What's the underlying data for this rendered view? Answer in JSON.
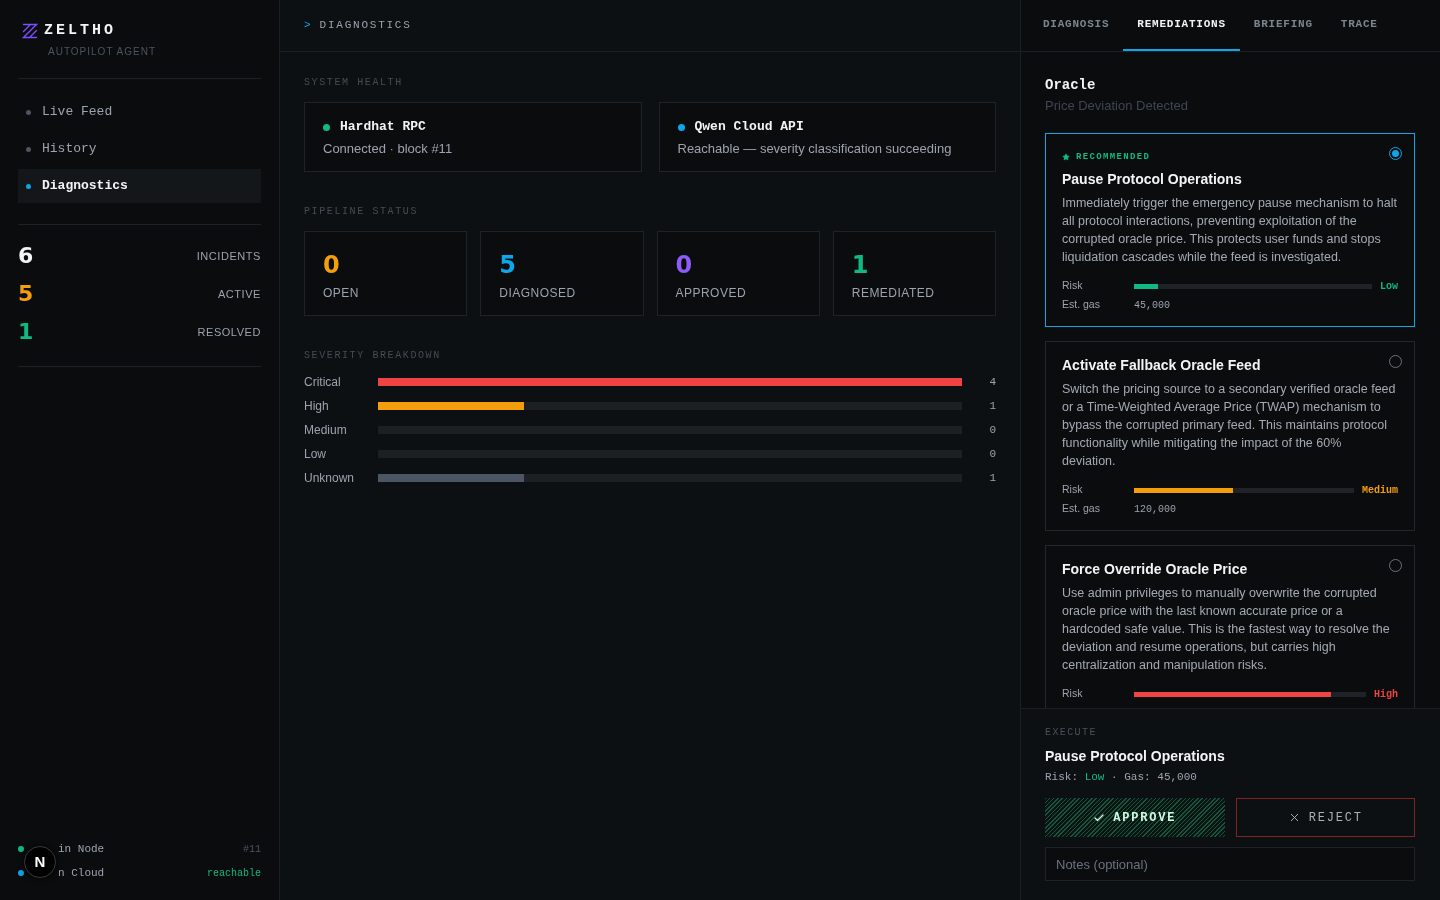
{
  "sidebar": {
    "logo": {
      "name": "ZELTHO",
      "tagline": "AUTOPILOT AGENT"
    },
    "nav": [
      {
        "label": "Live Feed",
        "selected": false
      },
      {
        "label": "History",
        "selected": false
      },
      {
        "label": "Diagnostics",
        "selected": true
      }
    ],
    "stats": [
      {
        "value": "6",
        "label": "INCIDENTS",
        "color": "#f3f4f6"
      },
      {
        "value": "5",
        "label": "ACTIVE",
        "color": "#f59e0b"
      },
      {
        "value": "1",
        "label": "RESOLVED",
        "color": "#10b981"
      }
    ],
    "services": [
      {
        "name": "in Node",
        "value": "#11",
        "color": "#10b981",
        "kind": "muted"
      },
      {
        "name": "n Cloud",
        "value": "reachable",
        "color": "#0ea5e9",
        "kind": "ok"
      }
    ]
  },
  "dev_badge": {
    "label": "N"
  },
  "main": {
    "breadcrumb": {
      "prompt": ">",
      "title": "DIAGNOSTICS"
    },
    "system_health": {
      "title": "SYSTEM HEALTH",
      "services": [
        {
          "name": "Hardhat RPC",
          "detail": "Connected · block #11",
          "color": "#10b981"
        },
        {
          "name": "Qwen Cloud API",
          "detail": "Reachable — severity classification succeeding",
          "color": "#0ea5e9"
        }
      ]
    },
    "pipeline_status": {
      "title": "PIPELINE STATUS",
      "stages": [
        {
          "count": "0",
          "label": "OPEN",
          "color": "#f59e0b"
        },
        {
          "count": "5",
          "label": "DIAGNOSED",
          "color": "#0ea5e9"
        },
        {
          "count": "0",
          "label": "APPROVED",
          "color": "#8b5cf6"
        },
        {
          "count": "1",
          "label": "REMEDIATED",
          "color": "#10b981"
        }
      ]
    },
    "severity_breakdown": {
      "title": "SEVERITY BREAKDOWN",
      "rows": [
        {
          "label": "Critical",
          "count": "4",
          "level": 1,
          "color": "#ef4444"
        },
        {
          "label": "High",
          "count": "1",
          "level": 0.25,
          "color": "#f59e0b"
        },
        {
          "label": "Medium",
          "count": "0"
        },
        {
          "label": "Low",
          "count": "0"
        },
        {
          "label": "Unknown",
          "count": "1",
          "level": 0.25,
          "color": "#4b5563"
        }
      ]
    }
  },
  "detail_panel": {
    "tabs": [
      {
        "label": "DIAGNOSIS",
        "selected": false
      },
      {
        "label": "REMEDIATIONS",
        "selected": true
      },
      {
        "label": "BRIEFING",
        "selected": false
      },
      {
        "label": "TRACE",
        "selected": false
      }
    ],
    "incident": {
      "title": "Oracle",
      "subtitle": "Price Deviation Detected"
    },
    "remediations": [
      {
        "badge": "RECOMMENDED",
        "title": "Pause Protocol Operations",
        "description": "Immediately trigger the emergency pause mechanism to halt all protocol interactions, preventing exploitation of the corrupted oracle price. This protects user funds and stops liquidation cascades while the feed is investigated.",
        "selected": true,
        "rows": [
          {
            "kind": "meter",
            "label": "Risk",
            "value": "Low",
            "level": 0.1,
            "color": "#10b981"
          },
          {
            "kind": "text",
            "label": "Est. gas",
            "value": "45,000"
          }
        ]
      },
      {
        "title": "Activate Fallback Oracle Feed",
        "description": "Switch the pricing source to a secondary verified oracle feed or a Time-Weighted Average Price (TWAP) mechanism to bypass the corrupted primary feed. This maintains protocol functionality while mitigating the impact of the 60% deviation.",
        "selected": false,
        "rows": [
          {
            "kind": "meter",
            "label": "Risk",
            "value": "Medium",
            "level": 0.45,
            "color": "#f59e0b"
          },
          {
            "kind": "text",
            "label": "Est. gas",
            "value": "120,000"
          }
        ]
      },
      {
        "title": "Force Override Oracle Price",
        "description": "Use admin privileges to manually overwrite the corrupted oracle price with the last known accurate price or a hardcoded safe value. This is the fastest way to resolve the deviation and resume operations, but carries high centralization and manipulation risks.",
        "selected": false,
        "rows": [
          {
            "kind": "meter",
            "label": "Risk",
            "value": "High",
            "level": 0.85,
            "color": "#ef4444"
          }
        ]
      }
    ],
    "execute": {
      "heading": "EXECUTE",
      "title": "Pause Protocol Operations",
      "summary": [
        {
          "text": "Risk:"
        },
        {
          "text": "Low",
          "color": "#10b981"
        },
        {
          "text": "·"
        },
        {
          "text": "Gas:"
        },
        {
          "text": "45,000"
        }
      ],
      "approve": "APPROVE",
      "reject": "REJECT",
      "notes": {
        "placeholder": "Notes (optional)"
      }
    }
  }
}
